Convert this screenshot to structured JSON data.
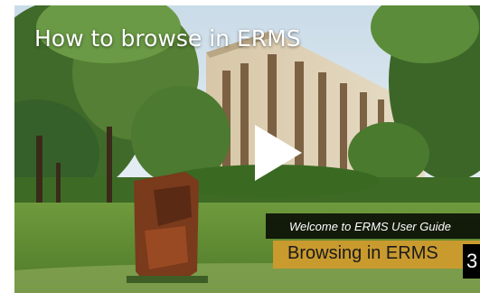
{
  "video": {
    "title": "How to browse in ERMS",
    "lower_third_top": "Welcome to ERMS User Guide",
    "lower_third_bottom": "Browsing in ERMS",
    "edge_badge": "3"
  },
  "icons": {
    "play": "play-icon"
  },
  "colors": {
    "title_text": "#ffffff",
    "lower_third_bar": "#000000",
    "lower_third_accent": "#c99a2e",
    "play_icon": "#ffffff"
  }
}
